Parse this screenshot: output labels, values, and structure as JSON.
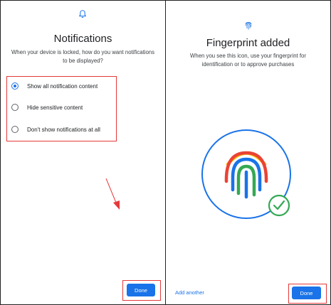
{
  "left_screen": {
    "title": "Notifications",
    "subtitle": "When your device is locked, how do you want notifications to be displayed?",
    "options": [
      {
        "label": "Show all notification content",
        "selected": true
      },
      {
        "label": "Hide sensitive content",
        "selected": false
      },
      {
        "label": "Don't show notifications at all",
        "selected": false
      }
    ],
    "done_label": "Done"
  },
  "right_screen": {
    "title": "Fingerprint added",
    "subtitle": "When you see this icon, use your fingerprint for identification or to approve purchases",
    "add_another_label": "Add another",
    "done_label": "Done"
  },
  "icons": {
    "notifications": "bell-icon",
    "fingerprint_header": "fingerprint-icon",
    "illustration": "fingerprint-illustration",
    "check": "check-circle-icon",
    "annotation": "red-arrow"
  },
  "colors": {
    "accent": "#1a73e8",
    "highlight": "#e5393a",
    "success": "#34a853"
  }
}
